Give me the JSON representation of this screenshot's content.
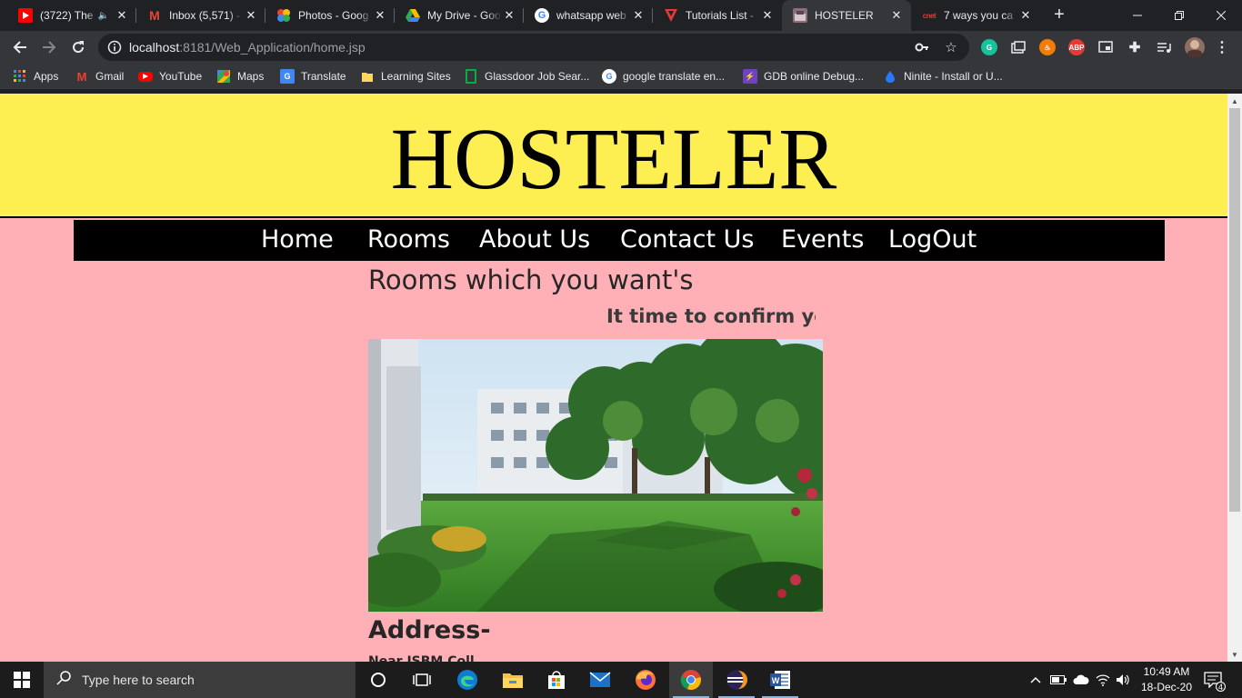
{
  "browser": {
    "tabs": [
      {
        "title": "(3722) The",
        "icon": "youtube-icon",
        "muted": true
      },
      {
        "title": "Inbox (5,571) -",
        "icon": "gmail-icon"
      },
      {
        "title": "Photos - Goog",
        "icon": "google-photos-icon"
      },
      {
        "title": "My Drive - Goo",
        "icon": "google-drive-icon"
      },
      {
        "title": "whatsapp web",
        "icon": "google-icon"
      },
      {
        "title": "Tutorials List -",
        "icon": "tutorials-icon"
      },
      {
        "title": "HOSTELER",
        "icon": "page-favicon",
        "active": true
      },
      {
        "title": "7 ways you ca",
        "icon": "cnet-icon",
        "icon_text": "cnet"
      }
    ],
    "url_host": "localhost",
    "url_rest": ":8181/Web_Application/home.jsp",
    "extension_abp_label": "ABP",
    "bookmarks": [
      {
        "label": "Apps",
        "icon": "apps-grid-icon"
      },
      {
        "label": "Gmail",
        "icon": "gmail-icon"
      },
      {
        "label": "YouTube",
        "icon": "youtube-icon"
      },
      {
        "label": "Maps",
        "icon": "google-maps-icon"
      },
      {
        "label": "Translate",
        "icon": "translate-icon"
      },
      {
        "label": "Learning Sites",
        "icon": "folder-icon"
      },
      {
        "label": "Glassdoor Job Sear...",
        "icon": "glassdoor-icon"
      },
      {
        "label": "google translate en...",
        "icon": "google-icon"
      },
      {
        "label": "GDB online Debug...",
        "icon": "gdb-icon"
      },
      {
        "label": "Ninite - Install or U...",
        "icon": "ninite-icon"
      }
    ]
  },
  "page": {
    "site_title": "HOSTELER",
    "nav": [
      "Home",
      "Rooms",
      "About Us",
      "Contact Us",
      "Events",
      "LogOut"
    ],
    "rooms_heading": "Rooms which you want's",
    "marquee_text": "It time to confirm you",
    "image_subject": "campus-building-lawn",
    "address_heading": "Address-",
    "address_line": "Near ISBM Coll..."
  },
  "taskbar": {
    "search_placeholder": "Type here to search",
    "time": "10:49 AM",
    "date": "18-Dec-20",
    "notification_count": "4"
  },
  "colors": {
    "header_bg": "#fdef52",
    "page_bg": "#ffb0b6",
    "nav_bg": "#000000"
  }
}
